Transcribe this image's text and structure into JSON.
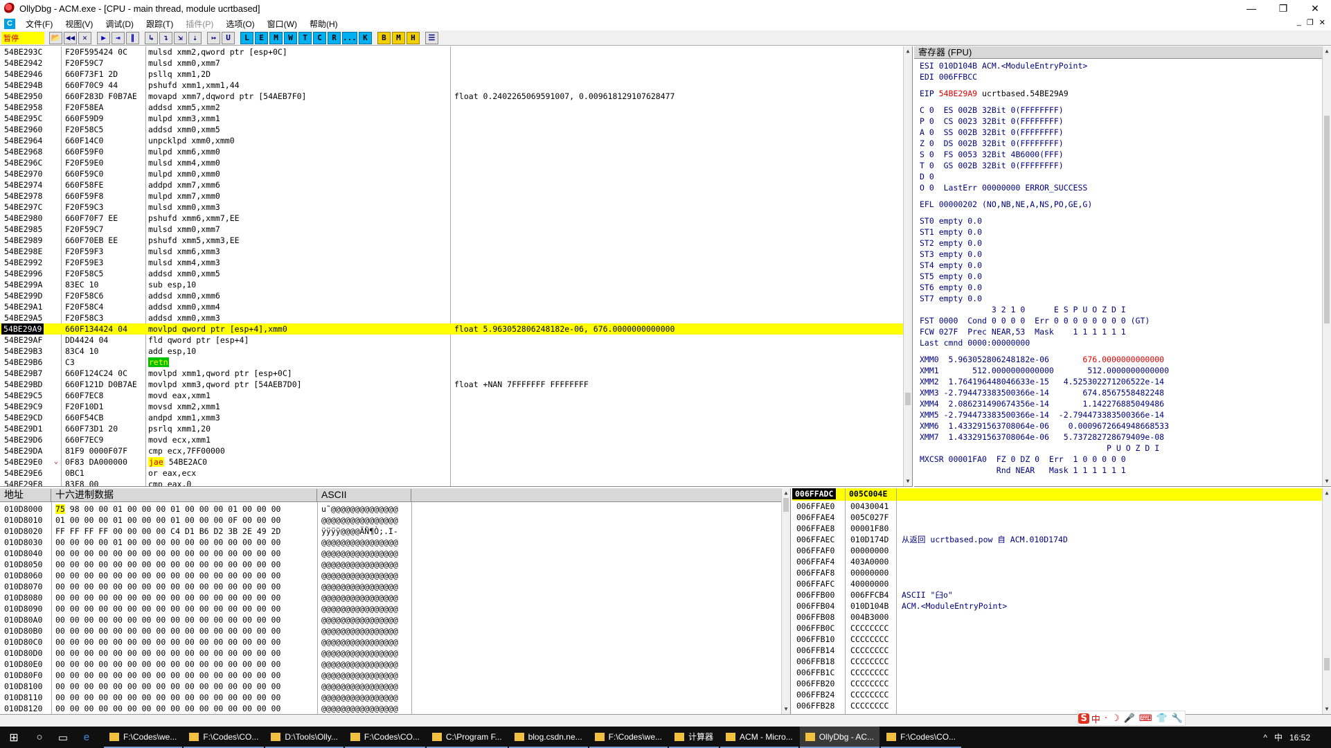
{
  "window": {
    "title": "OllyDbg - ACM.exe - [CPU - main thread, module ucrtbased]",
    "controls": [
      "—",
      "❐",
      "✕"
    ]
  },
  "menu": {
    "items": [
      "文件(F)",
      "视图(V)",
      "调试(D)",
      "跟踪(T)",
      "插件(P)",
      "选项(O)",
      "窗口(W)",
      "帮助(H)"
    ],
    "mdi": [
      "_",
      "❐",
      "✕"
    ]
  },
  "toolbar": {
    "status": "暂停",
    "buttons": [
      "📂",
      "◀◀",
      "✕",
      "▶",
      "⇥",
      "∥",
      "↳",
      "↴",
      "⇲",
      "⇣",
      "↦",
      "U"
    ],
    "letters": [
      "L",
      "E",
      "M",
      "W",
      "T",
      "C",
      "R",
      "...",
      "K"
    ],
    "letters2": [
      "B",
      "M",
      "H"
    ],
    "list_icon": "☰"
  },
  "disasm": {
    "rows": [
      {
        "addr": "54BE293C",
        "hex": "F20F595424 0C",
        "asm": "mulsd xmm2,qword ptr [esp+0C]",
        "cmt": ""
      },
      {
        "addr": "54BE2942",
        "hex": "F20F59C7",
        "asm": "mulsd xmm0,xmm7",
        "cmt": ""
      },
      {
        "addr": "54BE2946",
        "hex": "660F73F1 2D",
        "asm": "psllq xmm1,2D",
        "cmt": ""
      },
      {
        "addr": "54BE294B",
        "hex": "660F70C9 44",
        "asm": "pshufd xmm1,xmm1,44",
        "cmt": ""
      },
      {
        "addr": "54BE2950",
        "hex": "660F283D F0B7AE",
        "asm": "movapd xmm7,dqword ptr [54AEB7F0]",
        "cmt": "float 0.2402265069591007, 0.009618129107628477"
      },
      {
        "addr": "54BE2958",
        "hex": "F20F58EA",
        "asm": "addsd xmm5,xmm2",
        "cmt": ""
      },
      {
        "addr": "54BE295C",
        "hex": "660F59D9",
        "asm": "mulpd xmm3,xmm1",
        "cmt": ""
      },
      {
        "addr": "54BE2960",
        "hex": "F20F58C5",
        "asm": "addsd xmm0,xmm5",
        "cmt": ""
      },
      {
        "addr": "54BE2964",
        "hex": "660F14C0",
        "asm": "unpcklpd xmm0,xmm0",
        "cmt": ""
      },
      {
        "addr": "54BE2968",
        "hex": "660F59F0",
        "asm": "mulpd xmm6,xmm0",
        "cmt": ""
      },
      {
        "addr": "54BE296C",
        "hex": "F20F59E0",
        "asm": "mulsd xmm4,xmm0",
        "cmt": ""
      },
      {
        "addr": "54BE2970",
        "hex": "660F59C0",
        "asm": "mulpd xmm0,xmm0",
        "cmt": ""
      },
      {
        "addr": "54BE2974",
        "hex": "660F58FE",
        "asm": "addpd xmm7,xmm6",
        "cmt": ""
      },
      {
        "addr": "54BE2978",
        "hex": "660F59F8",
        "asm": "mulpd xmm7,xmm0",
        "cmt": ""
      },
      {
        "addr": "54BE297C",
        "hex": "F20F59C3",
        "asm": "mulsd xmm0,xmm3",
        "cmt": ""
      },
      {
        "addr": "54BE2980",
        "hex": "660F70F7 EE",
        "asm": "pshufd xmm6,xmm7,EE",
        "cmt": ""
      },
      {
        "addr": "54BE2985",
        "hex": "F20F59C7",
        "asm": "mulsd xmm0,xmm7",
        "cmt": ""
      },
      {
        "addr": "54BE2989",
        "hex": "660F70EB EE",
        "asm": "pshufd xmm5,xmm3,EE",
        "cmt": ""
      },
      {
        "addr": "54BE298E",
        "hex": "F20F59F3",
        "asm": "mulsd xmm6,xmm3",
        "cmt": ""
      },
      {
        "addr": "54BE2992",
        "hex": "F20F59E3",
        "asm": "mulsd xmm4,xmm3",
        "cmt": ""
      },
      {
        "addr": "54BE2996",
        "hex": "F20F58C5",
        "asm": "addsd xmm0,xmm5",
        "cmt": ""
      },
      {
        "addr": "54BE299A",
        "hex": "83EC 10",
        "asm": "sub esp,10",
        "cmt": ""
      },
      {
        "addr": "54BE299D",
        "hex": "F20F58C6",
        "asm": "addsd xmm0,xmm6",
        "cmt": ""
      },
      {
        "addr": "54BE29A1",
        "hex": "F20F58C4",
        "asm": "addsd xmm0,xmm4",
        "cmt": ""
      },
      {
        "addr": "54BE29A5",
        "hex": "F20F58C3",
        "asm": "addsd xmm0,xmm3",
        "cmt": ""
      },
      {
        "addr": "54BE29A9",
        "hex": "660F134424 04",
        "asm": "movlpd qword ptr [esp+4],xmm0",
        "cmt": "float 5.963052806248182e-06, 676.0000000000000",
        "cur": true
      },
      {
        "addr": "54BE29AF",
        "hex": "DD4424 04",
        "asm": "fld qword ptr [esp+4]",
        "cmt": ""
      },
      {
        "addr": "54BE29B3",
        "hex": "83C4 10",
        "asm": "add esp,10",
        "cmt": ""
      },
      {
        "addr": "54BE29B6",
        "hex": "C3",
        "asm": "retn",
        "cmt": "",
        "kind": "retn"
      },
      {
        "addr": "54BE29B7",
        "hex": "660F124C24 0C",
        "asm": "movlpd xmm1,qword ptr [esp+0C]",
        "cmt": ""
      },
      {
        "addr": "54BE29BD",
        "hex": "660F121D D0B7AE",
        "asm": "movlpd xmm3,qword ptr [54AEB7D0]",
        "cmt": "float +NAN 7FFFFFFF FFFFFFFF"
      },
      {
        "addr": "54BE29C5",
        "hex": "660F7EC8",
        "asm": "movd eax,xmm1",
        "cmt": ""
      },
      {
        "addr": "54BE29C9",
        "hex": "F20F10D1",
        "asm": "movsd xmm2,xmm1",
        "cmt": ""
      },
      {
        "addr": "54BE29CD",
        "hex": "660F54CB",
        "asm": "andpd xmm1,xmm3",
        "cmt": ""
      },
      {
        "addr": "54BE29D1",
        "hex": "660F73D1 20",
        "asm": "psrlq xmm1,20",
        "cmt": ""
      },
      {
        "addr": "54BE29D6",
        "hex": "660F7EC9",
        "asm": "movd ecx,xmm1",
        "cmt": ""
      },
      {
        "addr": "54BE29DA",
        "hex": "81F9 0000F07F",
        "asm": "cmp ecx,7FF00000",
        "cmt": ""
      },
      {
        "addr": "54BE29E0",
        "hex": "0F83 DA000000",
        "asm": "jae 54BE2AC0",
        "cmt": "",
        "kind": "jae"
      },
      {
        "addr": "54BE29E6",
        "hex": "0BC1",
        "asm": "or eax,ecx",
        "cmt": ""
      },
      {
        "addr": "54BE29E8",
        "hex": "83F8 00",
        "asm": "cmp eax,0",
        "cmt": ""
      }
    ]
  },
  "registers": {
    "title": "寄存器 (FPU)",
    "lines": [
      {
        "t": "ESI 010D104B ACM.<ModuleEntryPoint>"
      },
      {
        "t": "EDI 006FFBCC"
      },
      {
        "t": ""
      },
      {
        "t": "EIP ",
        "red": "54BE29A9",
        "rest": " ucrtbased.54BE29A9"
      },
      {
        "t": ""
      },
      {
        "t": "C 0  ES 002B 32Bit 0(FFFFFFFF)"
      },
      {
        "t": "P 0  CS 0023 32Bit 0(FFFFFFFF)"
      },
      {
        "t": "A 0  SS 002B 32Bit 0(FFFFFFFF)"
      },
      {
        "t": "Z 0  DS 002B 32Bit 0(FFFFFFFF)"
      },
      {
        "t": "S 0  FS 0053 32Bit 4B6000(FFF)"
      },
      {
        "t": "T 0  GS 002B 32Bit 0(FFFFFFFF)"
      },
      {
        "t": "D 0"
      },
      {
        "t": "O 0  LastErr 00000000 ERROR_SUCCESS"
      },
      {
        "t": ""
      },
      {
        "t": "EFL 00000202 (NO,NB,NE,A,NS,PO,GE,G)"
      },
      {
        "t": ""
      },
      {
        "t": "ST0 empty 0.0"
      },
      {
        "t": "ST1 empty 0.0"
      },
      {
        "t": "ST2 empty 0.0"
      },
      {
        "t": "ST3 empty 0.0"
      },
      {
        "t": "ST4 empty 0.0"
      },
      {
        "t": "ST5 empty 0.0"
      },
      {
        "t": "ST6 empty 0.0"
      },
      {
        "t": "ST7 empty 0.0"
      },
      {
        "t": "               3 2 1 0      E S P U O Z D I"
      },
      {
        "t": "FST 0000  Cond 0 0 0 0  Err 0 0 0 0 0 0 0 0 (GT)"
      },
      {
        "t": "FCW 027F  Prec NEAR,53  Mask    1 1 1 1 1 1"
      },
      {
        "t": "Last cmnd 0000:00000000"
      },
      {
        "t": ""
      },
      {
        "t": "XMM0  5.963052806248182e-06      ",
        "red": " 676.0000000000000"
      },
      {
        "t": "XMM1       512.0000000000000       512.0000000000000"
      },
      {
        "t": "XMM2  1.764196448046633e-15   4.525302271206522e-14"
      },
      {
        "t": "XMM3 -2.794473383500366e-14       674.8567558482248"
      },
      {
        "t": "XMM4  2.086231490674356e-14       1.142276885049486"
      },
      {
        "t": "XMM5 -2.794473383500366e-14  -2.794473383500366e-14"
      },
      {
        "t": "XMM6  1.433291563708064e-06    0.0009672664948668533"
      },
      {
        "t": "XMM7  1.433291563708064e-06   5.737282728679409e-08"
      },
      {
        "t": "                                       P U O Z D I"
      },
      {
        "t": "MXCSR 00001FA0  FZ 0 DZ 0  Err  1 0 0 0 0 0"
      },
      {
        "t": "                Rnd NEAR   Mask 1 1 1 1 1 1"
      }
    ]
  },
  "dump": {
    "headers": [
      "地址",
      "十六进制数据",
      "ASCII"
    ],
    "rows": [
      {
        "addr": "010D8000",
        "hex": "75 98 00 00 01 00 00 00 01 00 00 00 01 00 00 00",
        "ascii": "u˜@@@@@@@@@@@@@@"
      },
      {
        "addr": "010D8010",
        "hex": "01 00 00 00 01 00 00 00 01 00 00 00 0F 00 00 00",
        "ascii": "@@@@@@@@@@@@@@@@"
      },
      {
        "addr": "010D8020",
        "hex": "FF FF FF FF 00 00 00 00 C4 D1 B6 D2 3B 2E 49 2D",
        "ascii": "ÿÿÿÿ@@@@ÄÑ¶Ò;.I-"
      },
      {
        "addr": "010D8030",
        "hex": "00 00 00 00 01 00 00 00 00 00 00 00 00 00 00 00",
        "ascii": "@@@@@@@@@@@@@@@@"
      },
      {
        "addr": "010D8040",
        "hex": "00 00 00 00 00 00 00 00 00 00 00 00 00 00 00 00",
        "ascii": "@@@@@@@@@@@@@@@@"
      },
      {
        "addr": "010D8050",
        "hex": "00 00 00 00 00 00 00 00 00 00 00 00 00 00 00 00",
        "ascii": "@@@@@@@@@@@@@@@@"
      },
      {
        "addr": "010D8060",
        "hex": "00 00 00 00 00 00 00 00 00 00 00 00 00 00 00 00",
        "ascii": "@@@@@@@@@@@@@@@@"
      },
      {
        "addr": "010D8070",
        "hex": "00 00 00 00 00 00 00 00 00 00 00 00 00 00 00 00",
        "ascii": "@@@@@@@@@@@@@@@@"
      },
      {
        "addr": "010D8080",
        "hex": "00 00 00 00 00 00 00 00 00 00 00 00 00 00 00 00",
        "ascii": "@@@@@@@@@@@@@@@@"
      },
      {
        "addr": "010D8090",
        "hex": "00 00 00 00 00 00 00 00 00 00 00 00 00 00 00 00",
        "ascii": "@@@@@@@@@@@@@@@@"
      },
      {
        "addr": "010D80A0",
        "hex": "00 00 00 00 00 00 00 00 00 00 00 00 00 00 00 00",
        "ascii": "@@@@@@@@@@@@@@@@"
      },
      {
        "addr": "010D80B0",
        "hex": "00 00 00 00 00 00 00 00 00 00 00 00 00 00 00 00",
        "ascii": "@@@@@@@@@@@@@@@@"
      },
      {
        "addr": "010D80C0",
        "hex": "00 00 00 00 00 00 00 00 00 00 00 00 00 00 00 00",
        "ascii": "@@@@@@@@@@@@@@@@"
      },
      {
        "addr": "010D80D0",
        "hex": "00 00 00 00 00 00 00 00 00 00 00 00 00 00 00 00",
        "ascii": "@@@@@@@@@@@@@@@@"
      },
      {
        "addr": "010D80E0",
        "hex": "00 00 00 00 00 00 00 00 00 00 00 00 00 00 00 00",
        "ascii": "@@@@@@@@@@@@@@@@"
      },
      {
        "addr": "010D80F0",
        "hex": "00 00 00 00 00 00 00 00 00 00 00 00 00 00 00 00",
        "ascii": "@@@@@@@@@@@@@@@@"
      },
      {
        "addr": "010D8100",
        "hex": "00 00 00 00 00 00 00 00 00 00 00 00 00 00 00 00",
        "ascii": "@@@@@@@@@@@@@@@@"
      },
      {
        "addr": "010D8110",
        "hex": "00 00 00 00 00 00 00 00 00 00 00 00 00 00 00 00",
        "ascii": "@@@@@@@@@@@@@@@@"
      },
      {
        "addr": "010D8120",
        "hex": "00 00 00 00 00 00 00 00 00 00 00 00 00 00 00 00",
        "ascii": "@@@@@@@@@@@@@@@@"
      }
    ]
  },
  "stack": {
    "head_addr": "006FFADC",
    "head_val": "005C004E",
    "rows": [
      {
        "addr": "006FFAE0",
        "val": "00430041",
        "cmt": ""
      },
      {
        "addr": "006FFAE4",
        "val": "005C027F",
        "cmt": ""
      },
      {
        "addr": "006FFAE8",
        "val": "00001F80",
        "cmt": ""
      },
      {
        "addr": "006FFAEC",
        "val": "010D174D",
        "cmt": "从返回 ucrtbased.pow 自 ACM.010D174D"
      },
      {
        "addr": "006FFAF0",
        "val": "00000000",
        "cmt": ""
      },
      {
        "addr": "006FFAF4",
        "val": "403A0000",
        "cmt": ""
      },
      {
        "addr": "006FFAF8",
        "val": "00000000",
        "cmt": ""
      },
      {
        "addr": "006FFAFC",
        "val": "40000000",
        "cmt": ""
      },
      {
        "addr": "006FFB00",
        "val": "006FFCB4",
        "cmt": "ASCII \"臼o\""
      },
      {
        "addr": "006FFB04",
        "val": "010D104B",
        "cmt": "ACM.<ModuleEntryPoint>"
      },
      {
        "addr": "006FFB08",
        "val": "004B3000",
        "cmt": ""
      },
      {
        "addr": "006FFB0C",
        "val": "CCCCCCCC",
        "cmt": ""
      },
      {
        "addr": "006FFB10",
        "val": "CCCCCCCC",
        "cmt": ""
      },
      {
        "addr": "006FFB14",
        "val": "CCCCCCCC",
        "cmt": ""
      },
      {
        "addr": "006FFB18",
        "val": "CCCCCCCC",
        "cmt": ""
      },
      {
        "addr": "006FFB1C",
        "val": "CCCCCCCC",
        "cmt": ""
      },
      {
        "addr": "006FFB20",
        "val": "CCCCCCCC",
        "cmt": ""
      },
      {
        "addr": "006FFB24",
        "val": "CCCCCCCC",
        "cmt": ""
      },
      {
        "addr": "006FFB28",
        "val": "CCCCCCCC",
        "cmt": ""
      }
    ]
  },
  "ime": {
    "items": [
      "S",
      "中",
      "·",
      "☽",
      "🎤",
      "⌨",
      "👕",
      "🔧"
    ]
  },
  "taskbar": {
    "tasks": [
      {
        "label": "F:\\Codes\\we...",
        "active": false
      },
      {
        "label": "F:\\Codes\\CO...",
        "active": false
      },
      {
        "label": "D:\\Tools\\Olly...",
        "active": false
      },
      {
        "label": "F:\\Codes\\CO...",
        "active": false
      },
      {
        "label": "C:\\Program F...",
        "active": false
      },
      {
        "label": "blog.csdn.ne...",
        "active": false
      },
      {
        "label": "F:\\Codes\\we...",
        "active": false
      },
      {
        "label": "计算器",
        "active": false
      },
      {
        "label": "ACM - Micro...",
        "active": false
      },
      {
        "label": "OllyDbg - AC...",
        "active": true
      },
      {
        "label": "F:\\Codes\\CO...",
        "active": false
      }
    ],
    "tray": [
      "^",
      "中",
      "16:52"
    ]
  },
  "colors": {
    "accent_yellow": "#ffff00",
    "reg_blue": "#000080",
    "reg_red": "#e00000"
  }
}
